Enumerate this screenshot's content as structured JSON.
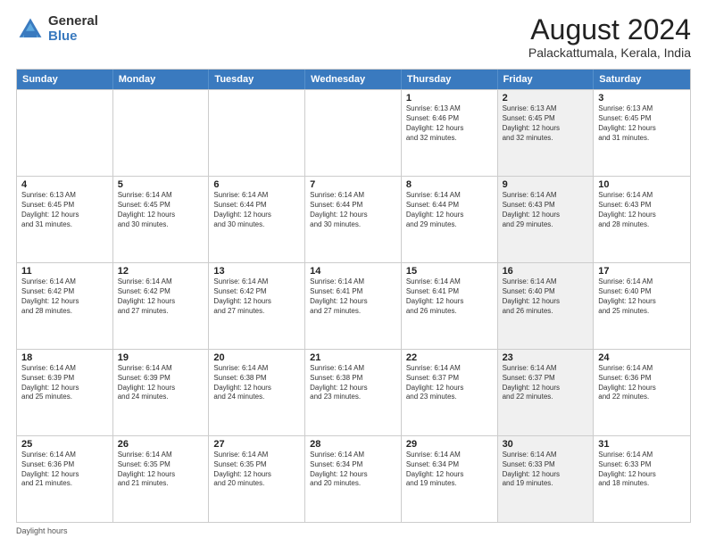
{
  "logo": {
    "general": "General",
    "blue": "Blue"
  },
  "title": "August 2024",
  "subtitle": "Palackattumala, Kerala, India",
  "weekdays": [
    "Sunday",
    "Monday",
    "Tuesday",
    "Wednesday",
    "Thursday",
    "Friday",
    "Saturday"
  ],
  "footer": "Daylight hours",
  "rows": [
    [
      {
        "day": "",
        "info": "",
        "shaded": false
      },
      {
        "day": "",
        "info": "",
        "shaded": false
      },
      {
        "day": "",
        "info": "",
        "shaded": false
      },
      {
        "day": "",
        "info": "",
        "shaded": false
      },
      {
        "day": "1",
        "info": "Sunrise: 6:13 AM\nSunset: 6:46 PM\nDaylight: 12 hours\nand 32 minutes.",
        "shaded": false
      },
      {
        "day": "2",
        "info": "Sunrise: 6:13 AM\nSunset: 6:45 PM\nDaylight: 12 hours\nand 32 minutes.",
        "shaded": true
      },
      {
        "day": "3",
        "info": "Sunrise: 6:13 AM\nSunset: 6:45 PM\nDaylight: 12 hours\nand 31 minutes.",
        "shaded": false
      }
    ],
    [
      {
        "day": "4",
        "info": "Sunrise: 6:13 AM\nSunset: 6:45 PM\nDaylight: 12 hours\nand 31 minutes.",
        "shaded": false
      },
      {
        "day": "5",
        "info": "Sunrise: 6:14 AM\nSunset: 6:45 PM\nDaylight: 12 hours\nand 30 minutes.",
        "shaded": false
      },
      {
        "day": "6",
        "info": "Sunrise: 6:14 AM\nSunset: 6:44 PM\nDaylight: 12 hours\nand 30 minutes.",
        "shaded": false
      },
      {
        "day": "7",
        "info": "Sunrise: 6:14 AM\nSunset: 6:44 PM\nDaylight: 12 hours\nand 30 minutes.",
        "shaded": false
      },
      {
        "day": "8",
        "info": "Sunrise: 6:14 AM\nSunset: 6:44 PM\nDaylight: 12 hours\nand 29 minutes.",
        "shaded": false
      },
      {
        "day": "9",
        "info": "Sunrise: 6:14 AM\nSunset: 6:43 PM\nDaylight: 12 hours\nand 29 minutes.",
        "shaded": true
      },
      {
        "day": "10",
        "info": "Sunrise: 6:14 AM\nSunset: 6:43 PM\nDaylight: 12 hours\nand 28 minutes.",
        "shaded": false
      }
    ],
    [
      {
        "day": "11",
        "info": "Sunrise: 6:14 AM\nSunset: 6:42 PM\nDaylight: 12 hours\nand 28 minutes.",
        "shaded": false
      },
      {
        "day": "12",
        "info": "Sunrise: 6:14 AM\nSunset: 6:42 PM\nDaylight: 12 hours\nand 27 minutes.",
        "shaded": false
      },
      {
        "day": "13",
        "info": "Sunrise: 6:14 AM\nSunset: 6:42 PM\nDaylight: 12 hours\nand 27 minutes.",
        "shaded": false
      },
      {
        "day": "14",
        "info": "Sunrise: 6:14 AM\nSunset: 6:41 PM\nDaylight: 12 hours\nand 27 minutes.",
        "shaded": false
      },
      {
        "day": "15",
        "info": "Sunrise: 6:14 AM\nSunset: 6:41 PM\nDaylight: 12 hours\nand 26 minutes.",
        "shaded": false
      },
      {
        "day": "16",
        "info": "Sunrise: 6:14 AM\nSunset: 6:40 PM\nDaylight: 12 hours\nand 26 minutes.",
        "shaded": true
      },
      {
        "day": "17",
        "info": "Sunrise: 6:14 AM\nSunset: 6:40 PM\nDaylight: 12 hours\nand 25 minutes.",
        "shaded": false
      }
    ],
    [
      {
        "day": "18",
        "info": "Sunrise: 6:14 AM\nSunset: 6:39 PM\nDaylight: 12 hours\nand 25 minutes.",
        "shaded": false
      },
      {
        "day": "19",
        "info": "Sunrise: 6:14 AM\nSunset: 6:39 PM\nDaylight: 12 hours\nand 24 minutes.",
        "shaded": false
      },
      {
        "day": "20",
        "info": "Sunrise: 6:14 AM\nSunset: 6:38 PM\nDaylight: 12 hours\nand 24 minutes.",
        "shaded": false
      },
      {
        "day": "21",
        "info": "Sunrise: 6:14 AM\nSunset: 6:38 PM\nDaylight: 12 hours\nand 23 minutes.",
        "shaded": false
      },
      {
        "day": "22",
        "info": "Sunrise: 6:14 AM\nSunset: 6:37 PM\nDaylight: 12 hours\nand 23 minutes.",
        "shaded": false
      },
      {
        "day": "23",
        "info": "Sunrise: 6:14 AM\nSunset: 6:37 PM\nDaylight: 12 hours\nand 22 minutes.",
        "shaded": true
      },
      {
        "day": "24",
        "info": "Sunrise: 6:14 AM\nSunset: 6:36 PM\nDaylight: 12 hours\nand 22 minutes.",
        "shaded": false
      }
    ],
    [
      {
        "day": "25",
        "info": "Sunrise: 6:14 AM\nSunset: 6:36 PM\nDaylight: 12 hours\nand 21 minutes.",
        "shaded": false
      },
      {
        "day": "26",
        "info": "Sunrise: 6:14 AM\nSunset: 6:35 PM\nDaylight: 12 hours\nand 21 minutes.",
        "shaded": false
      },
      {
        "day": "27",
        "info": "Sunrise: 6:14 AM\nSunset: 6:35 PM\nDaylight: 12 hours\nand 20 minutes.",
        "shaded": false
      },
      {
        "day": "28",
        "info": "Sunrise: 6:14 AM\nSunset: 6:34 PM\nDaylight: 12 hours\nand 20 minutes.",
        "shaded": false
      },
      {
        "day": "29",
        "info": "Sunrise: 6:14 AM\nSunset: 6:34 PM\nDaylight: 12 hours\nand 19 minutes.",
        "shaded": false
      },
      {
        "day": "30",
        "info": "Sunrise: 6:14 AM\nSunset: 6:33 PM\nDaylight: 12 hours\nand 19 minutes.",
        "shaded": true
      },
      {
        "day": "31",
        "info": "Sunrise: 6:14 AM\nSunset: 6:33 PM\nDaylight: 12 hours\nand 18 minutes.",
        "shaded": false
      }
    ]
  ]
}
